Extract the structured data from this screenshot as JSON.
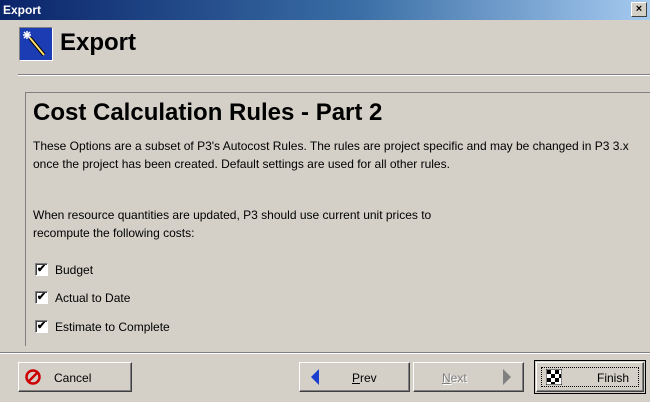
{
  "window": {
    "title": "Export",
    "close_glyph": "×"
  },
  "header": {
    "title": "Export",
    "icon": "magic-wand-icon"
  },
  "page": {
    "title": "Cost Calculation Rules - Part 2",
    "description": "These Options are a subset of P3's Autocost Rules.  The rules are project specific and may be changed in P3 3.x once the project has been created.  Default settings are used for all other rules.",
    "intro": "When resource quantities are updated, P3 should use current unit prices to recompute the following costs:"
  },
  "options": [
    {
      "label": "Budget",
      "checked": true
    },
    {
      "label": "Actual to Date",
      "checked": true
    },
    {
      "label": "Estimate to Complete",
      "checked": true
    }
  ],
  "buttons": {
    "cancel": "Cancel",
    "prev_first": "P",
    "prev_rest": "rev",
    "next_first": "N",
    "next_rest": "ext",
    "finish": "Finish"
  },
  "colors": {
    "titlebar_start": "#0a246a",
    "icon_bg": "#1c3cb4",
    "cancel_icon": "#cc0000",
    "arrow_active": "#1a3ccf",
    "arrow_disabled": "#808080"
  }
}
